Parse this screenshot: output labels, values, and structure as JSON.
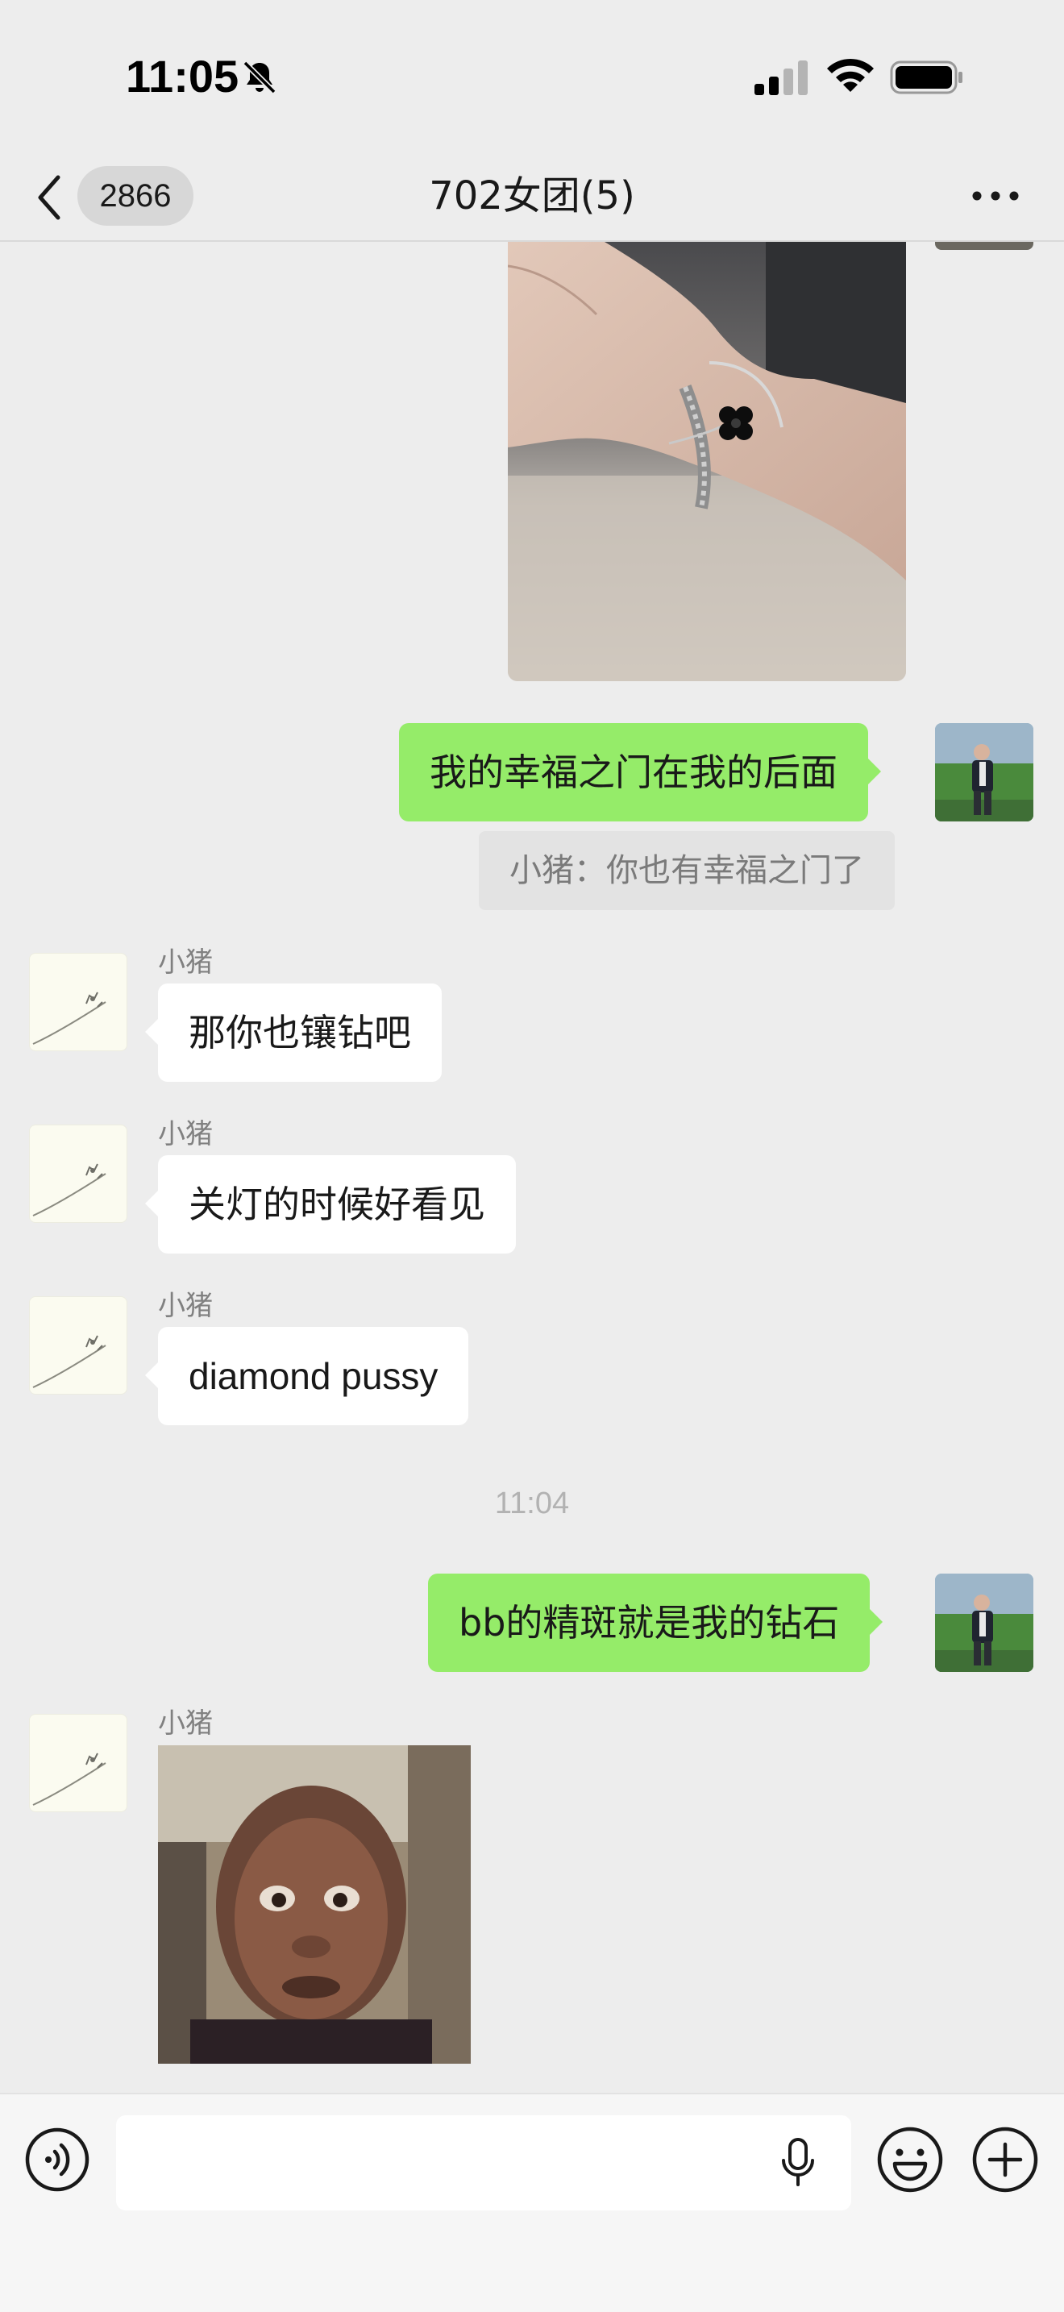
{
  "status_bar": {
    "time": "11:05",
    "icons": [
      "bell-slash-icon",
      "cellular-signal-icon",
      "wifi-icon",
      "battery-icon"
    ]
  },
  "nav": {
    "unread_count": "2866",
    "title": "702女团(5)",
    "icons": [
      "chevron-left-icon",
      "more-icon"
    ]
  },
  "messages": {
    "m1_text": "我的幸福之门在我的后面",
    "quote_text": "小猪：你也有幸福之门了",
    "m2_sender": "小猪",
    "m2_text": "那你也镶钻吧",
    "m3_sender": "小猪",
    "m3_text": "关灯的时候好看见",
    "m4_sender": "小猪",
    "m4_text": "diamond pussy",
    "time_divider": "11:04",
    "m5_text": "bb的精斑就是我的钻石",
    "m6_sender": "小猪"
  },
  "input_bar": {
    "text_value": "",
    "icons": [
      "voice-icon",
      "microphone-icon",
      "emoji-icon",
      "plus-icon"
    ]
  },
  "colors": {
    "background": "#ededed",
    "outgoing_bubble": "#95ec69",
    "incoming_bubble": "#ffffff",
    "quote_background": "#e3e3e3"
  }
}
